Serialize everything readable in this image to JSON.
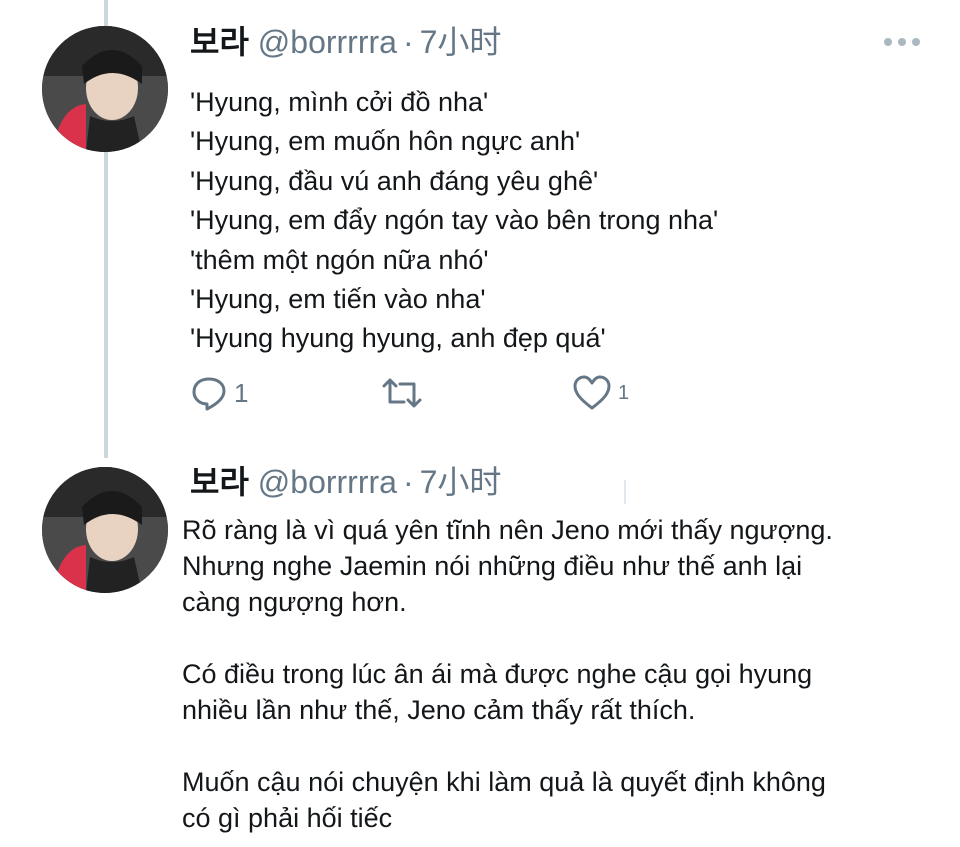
{
  "tweets": [
    {
      "name": "보라",
      "handle": "@borrrrra",
      "separator": "·",
      "time": "7小时",
      "lines": [
        "'Hyung, mình cởi đồ nha'",
        "'Hyung, em muốn hôn ngực anh'",
        "'Hyung, đầu vú anh đáng yêu ghê'",
        "'Hyung, em đẩy ngón tay vào bên trong nha'",
        "'thêm một ngón nữa nhó'",
        "'Hyung, em tiến vào nha'",
        "'Hyung hyung hyung, anh đẹp quá'"
      ],
      "reply_count": "1",
      "like_count": "1"
    },
    {
      "name": "보라",
      "handle": "@borrrrra",
      "separator": "·",
      "time": "7小时",
      "paragraphs": [
        [
          "Rõ ràng là vì quá yên tĩnh nên Jeno mới thấy ngượng.",
          "Nhưng nghe Jaemin nói những điều như thế anh lại",
          "càng ngượng hơn."
        ],
        [
          "Có điều trong lúc ân ái mà được nghe cậu gọi hyung",
          "nhiều lần như thế, Jeno cảm thấy rất thích."
        ],
        [
          "Muốn cậu nói chuyện khi làm quả là quyết định không",
          "có gì phải hối tiếc"
        ]
      ]
    }
  ],
  "colors": {
    "text": "#14171a",
    "muted": "#657786",
    "thread": "#ccd6dd"
  },
  "icons": [
    "more-icon",
    "reply-icon",
    "retweet-icon",
    "like-icon"
  ]
}
